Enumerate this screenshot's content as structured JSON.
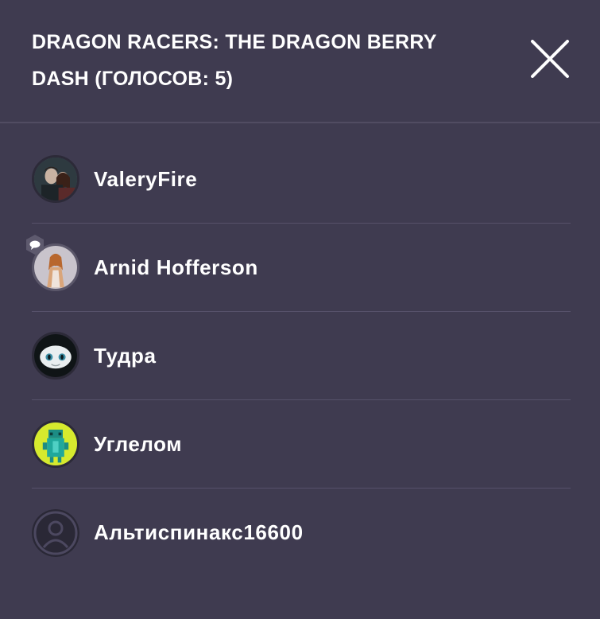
{
  "header": {
    "title": "DRAGON RACERS: THE DRAGON BERRY DASH (ГОЛОСОВ: 5)",
    "close_icon": "close-icon"
  },
  "voters": [
    {
      "name": "ValeryFire",
      "avatar": "photo-avatar"
    },
    {
      "name": "Arnid Hofferson",
      "avatar": "drawing-avatar",
      "badge": "chat-bubble-icon"
    },
    {
      "name": "Тудра",
      "avatar": "dragon-face-avatar"
    },
    {
      "name": "Углелом",
      "avatar": "green-dragon-avatar"
    },
    {
      "name": "Альтиспинакс16600",
      "avatar": "default-user-avatar"
    }
  ],
  "colors": {
    "background": "#3f3b50",
    "divider": "#56516a",
    "text": "#ffffff",
    "avatar_ring": "#2c2a38"
  }
}
